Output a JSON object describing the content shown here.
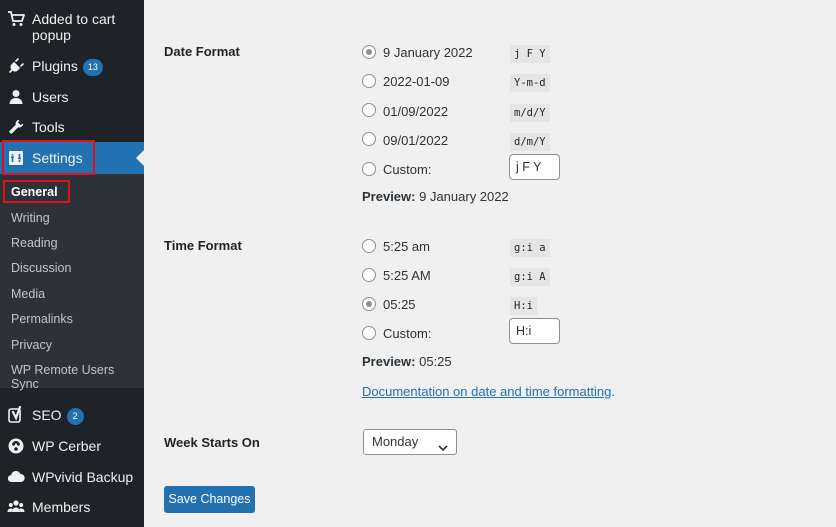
{
  "sidebar": {
    "top_items": [
      {
        "label": "Added to cart popup",
        "icon": "cart-icon"
      },
      {
        "label": "Plugins",
        "badge": "13",
        "icon": "plugin-icon"
      },
      {
        "label": "Users",
        "icon": "user-icon"
      },
      {
        "label": "Tools",
        "icon": "wrench-icon"
      },
      {
        "label": "Settings",
        "icon": "settings-icon",
        "current": true
      }
    ],
    "submenu": [
      "General",
      "Writing",
      "Reading",
      "Discussion",
      "Media",
      "Permalinks",
      "Privacy",
      "WP Remote Users Sync"
    ],
    "bottom_items": [
      {
        "label": "SEO",
        "badge": "2",
        "icon": "yoast-icon"
      },
      {
        "label": "WP Cerber",
        "icon": "cerber-icon"
      },
      {
        "label": "WPvivid Backup",
        "icon": "cloud-icon"
      },
      {
        "label": "Members",
        "icon": "members-icon"
      }
    ],
    "colors": {
      "bg": "#1d2327",
      "submenu_bg": "#2c3338",
      "current": "#2271b1",
      "highlight": "#e0111d"
    }
  },
  "date_format": {
    "label": "Date Format",
    "options": [
      {
        "text": "9 January 2022",
        "code": "j F Y",
        "checked": true
      },
      {
        "text": "2022-01-09",
        "code": "Y-m-d",
        "checked": false
      },
      {
        "text": "01/09/2022",
        "code": "m/d/Y",
        "checked": false
      },
      {
        "text": "09/01/2022",
        "code": "d/m/Y",
        "checked": false
      }
    ],
    "custom_label": "Custom:",
    "custom_value": "j F Y",
    "preview_label": "Preview:",
    "preview_value": "9 January 2022"
  },
  "time_format": {
    "label": "Time Format",
    "options": [
      {
        "text": "5:25 am",
        "code": "g:i a",
        "checked": false
      },
      {
        "text": "5:25 AM",
        "code": "g:i A",
        "checked": false
      },
      {
        "text": "05:25",
        "code": "H:i",
        "checked": true
      }
    ],
    "custom_label": "Custom:",
    "custom_value": "H:i",
    "preview_label": "Preview:",
    "preview_value": "05:25"
  },
  "doc_link": {
    "text": "Documentation on date and time formatting",
    "suffix": "."
  },
  "week_starts": {
    "label": "Week Starts On",
    "value": "Monday"
  },
  "save_label": "Save Changes"
}
